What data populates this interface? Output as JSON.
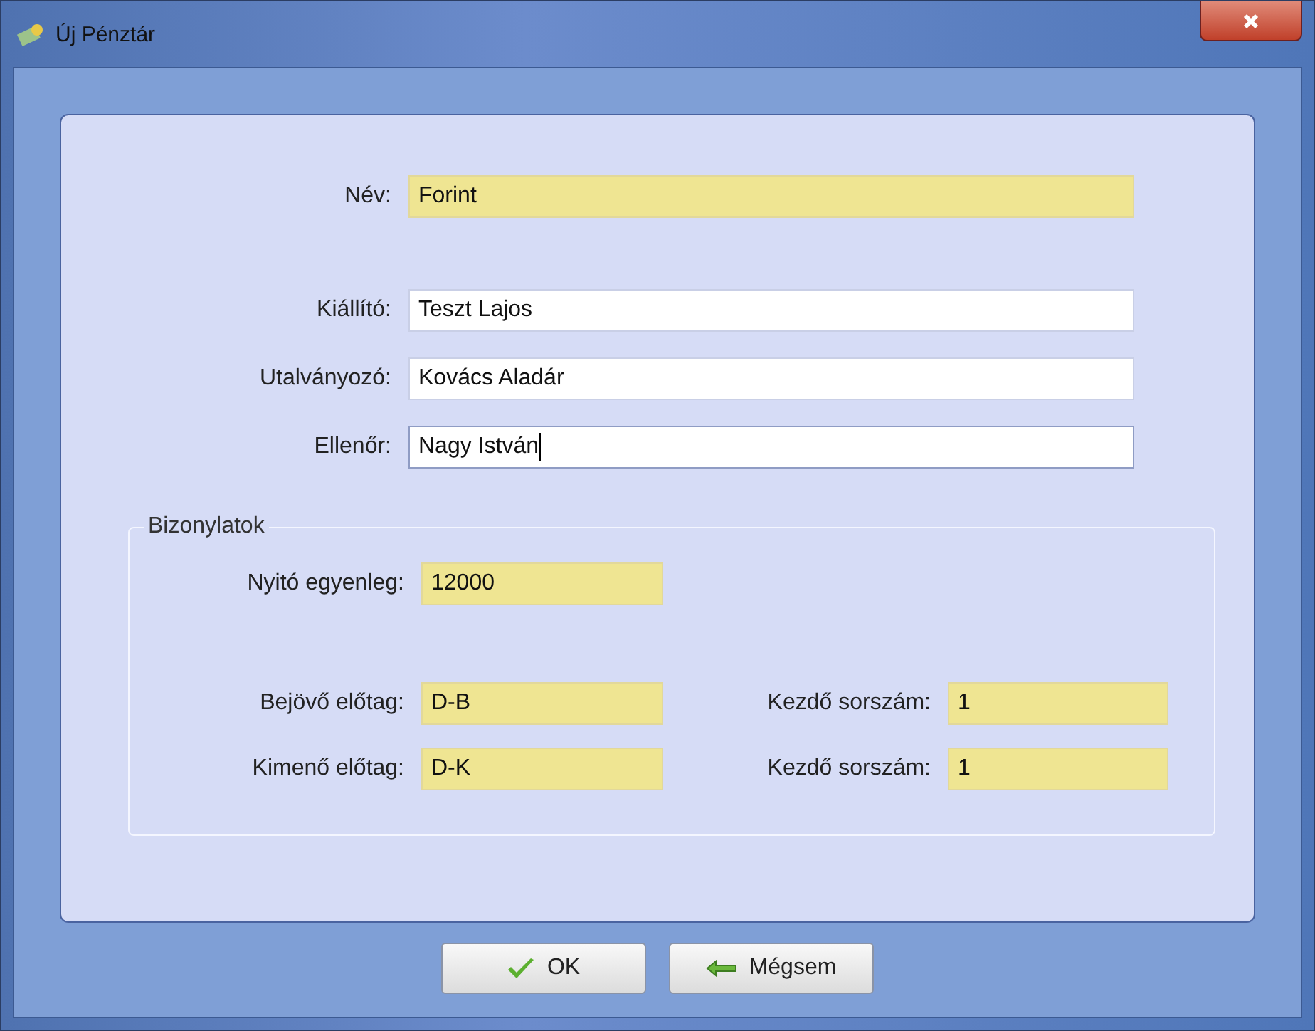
{
  "window": {
    "title": "Új Pénztár"
  },
  "fields": [
    {
      "label": "Név:",
      "value": "Forint",
      "required": true,
      "focused": false
    },
    {
      "label": "Kiállító:",
      "value": "Teszt Lajos",
      "required": false,
      "focused": false
    },
    {
      "label": "Utalványozó:",
      "value": "Kovács Aladár",
      "required": false,
      "focused": false
    },
    {
      "label": "Ellenőr:",
      "value": "Nagy István",
      "required": false,
      "focused": true
    }
  ],
  "group": {
    "title": "Bizonylatok",
    "opening": {
      "label": "Nyitó egyenleg:",
      "value": "12000",
      "required": true
    },
    "rows": [
      {
        "label": "Bejövő előtag:",
        "value": "D-B",
        "required": true,
        "number_label": "Kezdő sorszám:",
        "number_value": "1",
        "number_required": true
      },
      {
        "label": "Kimenő előtag:",
        "value": "D-K",
        "required": true,
        "number_label": "Kezdő sorszám:",
        "number_value": "1",
        "number_required": true
      }
    ]
  },
  "buttons": [
    {
      "label": "OK",
      "kind": "ok"
    },
    {
      "label": "Mégsem",
      "kind": "cancel"
    }
  ]
}
